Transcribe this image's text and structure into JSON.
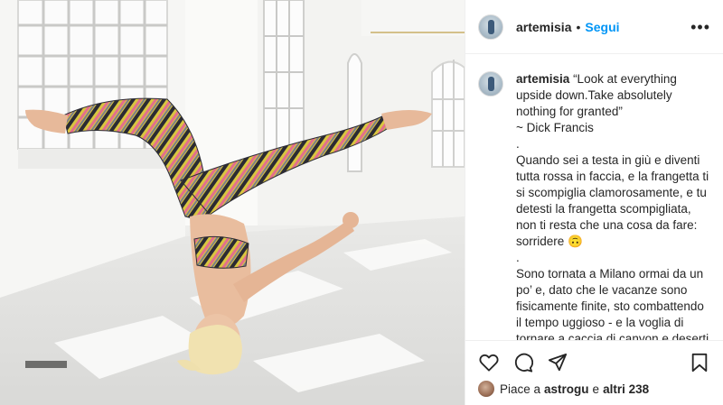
{
  "post": {
    "username": "artemisia",
    "separator": "•",
    "follow_label": "Segui",
    "more_icon": "more-options-icon"
  },
  "caption": {
    "username": "artemisia",
    "lines": [
      "“Look at everything upside down.Take absolutely nothing for granted”",
      "~ Dick Francis",
      ".",
      "Quando sei a testa in giù e diventi tutta rossa in faccia, e la frangetta ti si scompiglia clamorosamente, e tu detesti la frangetta scompigliata, non ti resta che una cosa da fare: sorridere 🙃",
      ".",
      "Sono tornata a Milano ormai da un po’ e, dato che le vacanze sono fisicamente finite, sto combattendo il tempo uggioso - e la voglia di tornare a caccia di canyon e deserti - concentrandomi su tutte le cose belle che posso fare qui."
    ]
  },
  "actions": {
    "icons": [
      "heart-icon",
      "comment-icon",
      "share-icon",
      "bookmark-icon"
    ]
  },
  "likes": {
    "prefix": "Piace a",
    "user": "astrogu",
    "conjunction": "e",
    "others": "altri 238"
  },
  "colors": {
    "accent": "#0095f6",
    "text": "#262626",
    "border": "#efefef"
  }
}
